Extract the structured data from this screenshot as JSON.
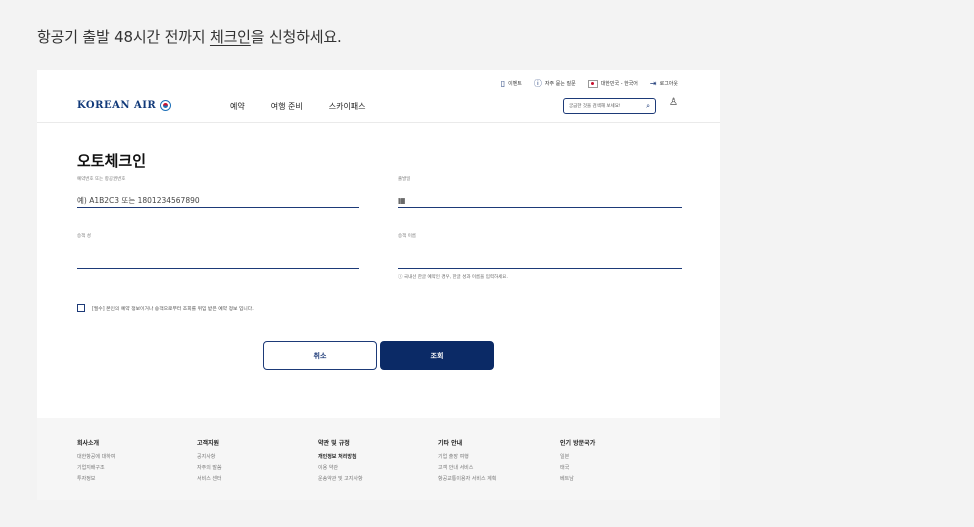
{
  "intro": {
    "prefix": "항공기 출발 48시간 전까지 ",
    "link": "체크인",
    "suffix": "을 신청하세요."
  },
  "utility": {
    "event": "이벤트",
    "faq": "자주 묻는 질문",
    "region": "대한민국 - 한국어",
    "logout": "로그아웃"
  },
  "logo": {
    "text": "KOREAN AIR"
  },
  "gnb": {
    "items": [
      "예약",
      "여행 준비",
      "스카이패스"
    ]
  },
  "search": {
    "placeholder": "궁금한 것을 검색해 보세요!"
  },
  "form": {
    "title": "오토체크인",
    "booking_label": "예약번호 또는 항공권번호",
    "booking_placeholder": "예) A1B2C3 또는 1801234567890",
    "date_label": "출발일",
    "surname_label": "승객 성",
    "givenname_label": "승객 이름",
    "hint": "ⓘ 국내선 한글 예약인 경우, 한글 성과 이름을 입력하세요.",
    "agree": "[필수] 본인의 예약 정보이거나 승객으로부터 조회를 위임 받은 예약 정보 입니다.",
    "cancel": "취소",
    "submit": "조회"
  },
  "footer": {
    "company": {
      "title": "회사소개",
      "items": [
        "대한항공에 대하여",
        "기업지배구조",
        "투자정보"
      ]
    },
    "support": {
      "title": "고객지원",
      "items": [
        "공지사항",
        "자주의 말씀",
        "서비스 센터"
      ]
    },
    "terms": {
      "title": "약관 및 규정",
      "items": [
        "개인정보 처리방침",
        "이용 약관",
        "운송약관 및 고지사항"
      ]
    },
    "etc": {
      "title": "기타 안내",
      "items": [
        "기업 출장 여행",
        "고객 안내 서비스",
        "항공교통이용자 서비스 계획"
      ]
    },
    "popular": {
      "title": "인기 방문국가",
      "items": [
        "일본",
        "태국",
        "베트남"
      ]
    }
  },
  "colors": {
    "brand": "#0b2a66",
    "accent": "#1d3a78",
    "page_bg": "#f3f3f3"
  },
  "icons": [
    "calendar-icon",
    "help-circle-icon",
    "flag-icon",
    "logout-icon",
    "search-icon",
    "user-icon"
  ]
}
